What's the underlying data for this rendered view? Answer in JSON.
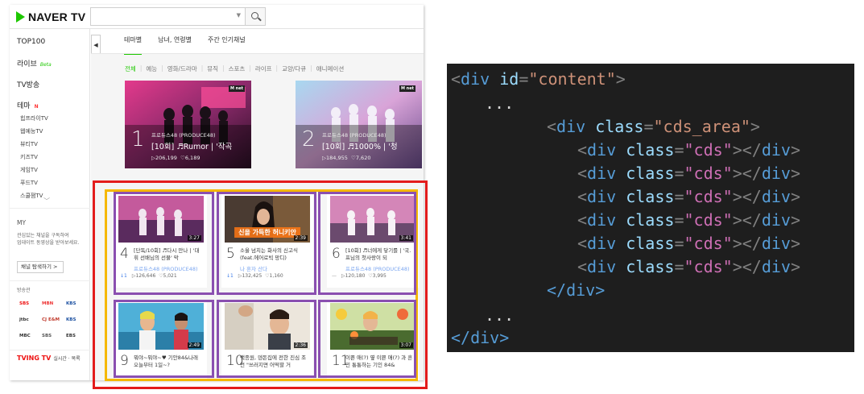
{
  "naver": {
    "logo_text": "NAVER TV",
    "brand_color": "#1ec800",
    "search_placeholder": "",
    "sidebar": {
      "top100": "TOP100",
      "live": "라이브",
      "live_badge": "Beta",
      "tv": "TV방송",
      "theme": "테마",
      "theme_badge": "N",
      "theme_items": [
        "힙프라이TV",
        "웹예능TV",
        "뷰티TV",
        "키즈TV",
        "게임TV",
        "푸드TV",
        "스쿨잼TV"
      ],
      "my": "MY",
      "my_desc": [
        "관심있는 채널을 구독하여",
        "업데이트 동영상을 받아보세요."
      ],
      "subscribe_btn": "채널 탐색하기 >",
      "broadcast_label": "방송관",
      "broadcasters": [
        "SBS",
        "MBN",
        "KBS",
        "jtbc",
        "CJ E&M",
        "KBS",
        "MBC",
        "SBS",
        "EBS"
      ],
      "tving": "TVING TV",
      "tving_sub": "실시간 · 목록"
    },
    "tabs": [
      "테마별",
      "남녀, 연령별",
      "주간 인기채널"
    ],
    "categories": [
      "전체",
      "예능",
      "영화/드라마",
      "뮤직",
      "스포츠",
      "라이프",
      "교양/다큐",
      "애니메이션"
    ],
    "heroes": [
      {
        "rank": "1",
        "channel": "프로듀스48 (PRODUCE48)",
        "title": "[10회] ♬Rumor | '작곡",
        "plays": "▷206,199",
        "likes": "♡6,189"
      },
      {
        "rank": "2",
        "channel": "프로듀스48 (PRODUCE48)",
        "title": "[10회] ♬1000% | '청",
        "plays": "▷184,955",
        "likes": "♡7,620"
      }
    ],
    "cards": [
      {
        "rank": "4",
        "duration": "3:27",
        "title": "[단독/10회] ♬다시 만나 | '대휘 선배님의 선물' 막",
        "channel": "프로듀스48 (PRODUCE48)",
        "trend": "↓1",
        "plays": "▷126,646",
        "likes": "♡5,021"
      },
      {
        "rank": "5",
        "duration": "2:39",
        "title": "소울 넘치는 화사의 신고식 (feat.에어로빅 망디)",
        "channel": "나 혼자 산다",
        "trend": "↓1",
        "plays": "▷132,425",
        "likes": "♡1,160",
        "caption": "신을 가득한 허니키안"
      },
      {
        "rank": "6",
        "duration": "3:41",
        "title": "[10회] ♬너에게 닿기를 | '국.프님의 첫사랑이 되",
        "channel": "프로듀스48 (PRODUCE48)",
        "trend": "—",
        "plays": "▷120,180",
        "likes": "♡3,995"
      },
      {
        "rank": "9",
        "duration": "2:49",
        "title": "뭐야~뭐야~♥ 기안84&나래 오늘부터 1일~?",
        "channel": "",
        "trend": "",
        "plays": "",
        "likes": ""
      },
      {
        "rank": "10",
        "duration": "2:36",
        "title": "백종원, 덴돈집에 전한 진심 조언 \"쓰러지면 어떡할 거",
        "channel": "",
        "trend": "",
        "plays": "",
        "likes": ""
      },
      {
        "rank": "11",
        "duration": "3:07",
        "title": "이쁜 애(?) 옆 이쁜 애(?) 과 흔민 통통하는 기인 84&",
        "channel": "",
        "trend": "",
        "plays": "",
        "likes": ""
      }
    ]
  },
  "annotation_colors": {
    "red": "#e31c1c",
    "orange": "#f5b800",
    "purple": "#8a4fb0"
  },
  "code": {
    "l1_tag": "div",
    "l1_attr": "id",
    "l1_val": "\"content\"",
    "ellipsis": "...",
    "area_tag": "div",
    "area_attr": "class",
    "area_val": "\"cds_area\"",
    "cds_tag": "div",
    "cds_attr": "class",
    "cds_val": "\"cds\"",
    "close_div": "</div>"
  }
}
